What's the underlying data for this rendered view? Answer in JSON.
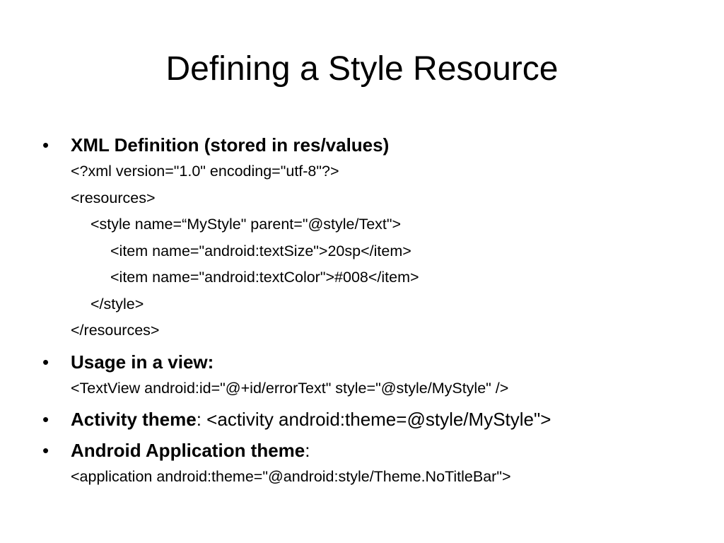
{
  "slide": {
    "title": "Defining a Style Resource",
    "bullet_glyph": "•",
    "bullets": [
      {
        "heading": "XML Definition (stored in res/values)",
        "suffix": "",
        "lines": [
          "<?xml version=\"1.0\" encoding=\"utf-8\"?>",
          "<resources>",
          "<style name=“MyStyle\" parent=\"@style/Text\">",
          "<item name=\"android:textSize\">20sp</item>",
          "<item name=\"android:textColor\">#008</item>",
          "</style>",
          "</resources>"
        ]
      },
      {
        "heading": "Usage in a view:",
        "suffix": "",
        "lines": [
          "<TextView android:id=\"@+id/errorText\" style=\"@style/MyStyle\" />"
        ]
      },
      {
        "heading": "Activity theme",
        "suffix": ": <activity android:theme=@style/MyStyle\">",
        "lines": []
      },
      {
        "heading": "Android Application theme",
        "suffix": ":",
        "lines": [
          "<application android:theme=\"@android:style/Theme.NoTitleBar\">"
        ]
      }
    ]
  }
}
